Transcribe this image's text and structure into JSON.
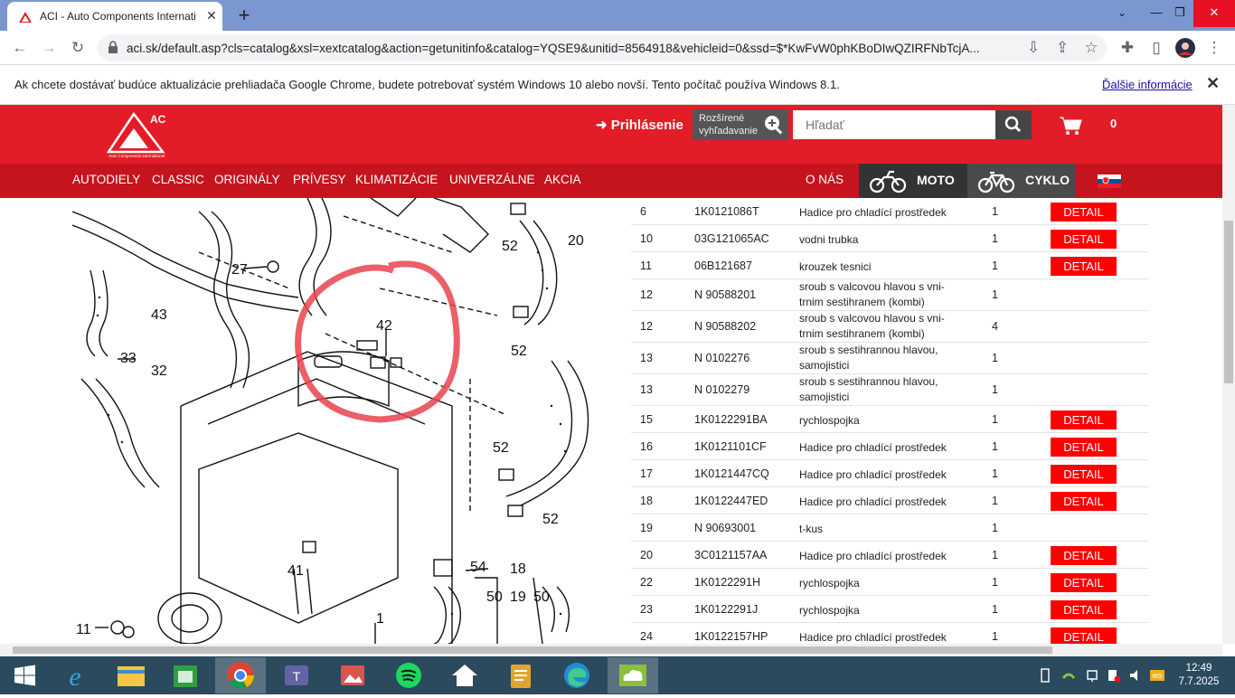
{
  "browser": {
    "tab_title": "ACI - Auto Components Internati",
    "url": "aci.sk/default.asp?cls=catalog&xsl=xextcatalog&action=getunitinfo&catalog=YQSE9&unitid=8564918&vehicleid=0&ssd=$*KwFvW0phKBoDIwQZIRFNbTcjA...",
    "infobar_text": "Ak chcete dostávať budúce aktualizácie prehliadača Google Chrome, budete potrebovať systém Windows 10 alebo novší. Tento počítač používa Windows 8.1.",
    "infobar_link": "Ďalšie informácie"
  },
  "header": {
    "logo_text": "ACI",
    "logo_subtext": "Auto Components International",
    "login_label": "Prihlásenie",
    "advanced_search": [
      "Rozšírené",
      "vyhľadavanie"
    ],
    "search_placeholder": "Hľadať",
    "cart_count": "0"
  },
  "nav": {
    "items": [
      "AUTODIELY",
      "CLASSIC",
      "ORIGINÁLY",
      "PRÍVESY",
      "KLIMATIZÁCIE",
      "UNIVERZÁLNE",
      "AKCIA"
    ],
    "about": "O NÁS",
    "moto": "MOTO",
    "cyklo": "CYKLO"
  },
  "diagram": {
    "callouts": [
      "42",
      "52",
      "20",
      "27",
      "43",
      "33",
      "32",
      "52",
      "52",
      "52",
      "41",
      "54",
      "18",
      "50",
      "19",
      "50",
      "11",
      "1"
    ]
  },
  "parts": {
    "detail_label": "DETAIL",
    "rows": [
      {
        "pos": "6",
        "number": "1K0121086T",
        "name": [
          "Hadice pro chladící prostředek"
        ],
        "qty": "1",
        "detail": true
      },
      {
        "pos": "10",
        "number": "03G121065AC",
        "name": [
          "vodni trubka"
        ],
        "qty": "1",
        "detail": true
      },
      {
        "pos": "11",
        "number": "06B121687",
        "name": [
          "krouzek tesnici"
        ],
        "qty": "1",
        "detail": true
      },
      {
        "pos": "12",
        "number": "N 90588201",
        "name": [
          "sroub s valcovou hlavou s vni-",
          "trnim sestihranem (kombi)"
        ],
        "qty": "1",
        "detail": false
      },
      {
        "pos": "12",
        "number": "N 90588202",
        "name": [
          "sroub s valcovou hlavou s vni-",
          "trnim sestihranem (kombi)"
        ],
        "qty": "4",
        "detail": false
      },
      {
        "pos": "13",
        "number": "N 0102276",
        "name": [
          "sroub s sestihrannou hlavou,",
          "samojistici"
        ],
        "qty": "1",
        "detail": false
      },
      {
        "pos": "13",
        "number": "N 0102279",
        "name": [
          "sroub s sestihrannou hlavou,",
          "samojistici"
        ],
        "qty": "1",
        "detail": false
      },
      {
        "pos": "15",
        "number": "1K0122291BA",
        "name": [
          "rychlospojka"
        ],
        "qty": "1",
        "detail": true
      },
      {
        "pos": "16",
        "number": "1K0121101CF",
        "name": [
          "Hadice pro chladící prostředek"
        ],
        "qty": "1",
        "detail": true
      },
      {
        "pos": "17",
        "number": "1K0121447CQ",
        "name": [
          "Hadice pro chladící prostředek"
        ],
        "qty": "1",
        "detail": true
      },
      {
        "pos": "18",
        "number": "1K0122447ED",
        "name": [
          "Hadice pro chladící prostředek"
        ],
        "qty": "1",
        "detail": true
      },
      {
        "pos": "19",
        "number": "N 90693001",
        "name": [
          "t-kus"
        ],
        "qty": "1",
        "detail": false
      },
      {
        "pos": "20",
        "number": "3C0121157AA",
        "name": [
          "Hadice pro chladící prostředek"
        ],
        "qty": "1",
        "detail": true
      },
      {
        "pos": "22",
        "number": "1K0122291H",
        "name": [
          "rychlospojka"
        ],
        "qty": "1",
        "detail": true
      },
      {
        "pos": "23",
        "number": "1K0122291J",
        "name": [
          "rychlospojka"
        ],
        "qty": "1",
        "detail": true
      },
      {
        "pos": "24",
        "number": "1K0122157HP",
        "name": [
          "Hadice pro chladící prostředek"
        ],
        "qty": "1",
        "detail": true
      }
    ]
  },
  "taskbar": {
    "apps": [
      "start",
      "internet-explorer",
      "file-explorer",
      "store",
      "chrome",
      "teams",
      "photos",
      "spotify",
      "home",
      "notes",
      "edge",
      "cloud-app"
    ],
    "time": "12:49",
    "date": "7.7.2025",
    "ime": "WS"
  },
  "colors": {
    "brand_red": "#e31d27",
    "nav_red": "#c5141d",
    "detail_red": "#ff0000",
    "tab_strip": "#7b97cf",
    "taskbar": "#2b4a5d"
  }
}
